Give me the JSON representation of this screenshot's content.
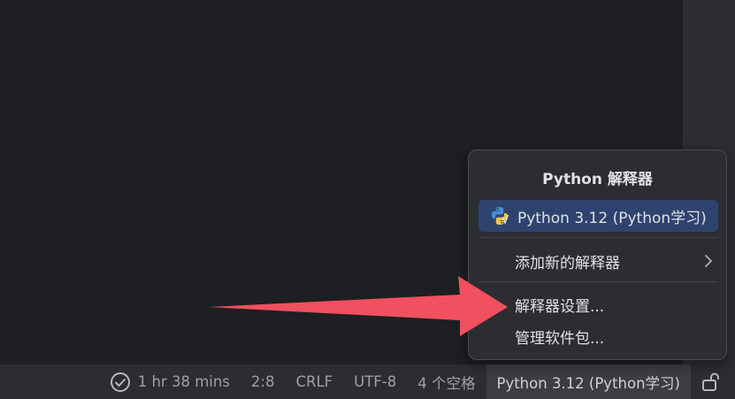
{
  "statusbar": {
    "time_tracked": "1 hr 38 mins",
    "cursor_position": "2:8",
    "line_ending": "CRLF",
    "encoding": "UTF-8",
    "indent": "4 个空格",
    "interpreter": "Python 3.12 (Python学习)"
  },
  "popup": {
    "title": "Python 解释器",
    "current_interpreter": "Python 3.12 (Python学习)",
    "add_new": "添加新的解释器",
    "settings": "解释器设置...",
    "manage_packages": "管理软件包..."
  },
  "colors": {
    "editor_bg": "#1e1f22",
    "panel_bg": "#2b2d30",
    "selection": "#2e436e",
    "arrow": "#f0505f"
  },
  "icons": [
    "check-circle-icon",
    "python-icon",
    "chevron-right-icon",
    "lock-icon",
    "arrow-annotation"
  ]
}
